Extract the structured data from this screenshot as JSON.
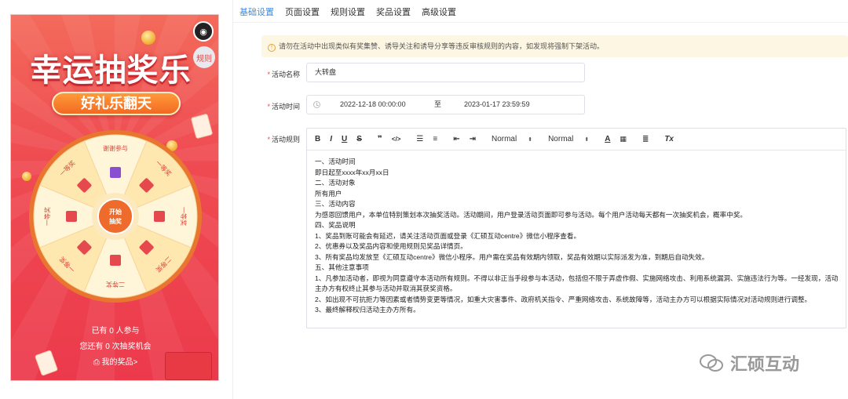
{
  "phone": {
    "title": "幸运抽奖乐",
    "subtitle": "好礼乐翻天",
    "rules_badge": "规则",
    "logo_glyph": "◉",
    "wheel": {
      "center_label_line1": "开始",
      "center_label_line2": "抽奖",
      "segments": [
        "谢谢参与",
        "一等奖",
        "一等奖",
        "二等奖",
        "二等奖",
        "一等奖",
        "一等奖",
        "一等奖"
      ]
    },
    "stats": {
      "participants": "已有 0 人参与",
      "chances": "您还有 0 次抽奖机会",
      "my_prizes": "我的奖品>"
    }
  },
  "tabs": [
    "基础设置",
    "页面设置",
    "规则设置",
    "奖品设置",
    "高级设置"
  ],
  "notice": "请勿在活动中出现类似有奖集赞、诱导关注和诱导分享等违反审核规则的内容，如发现将强制下架活动。",
  "form": {
    "name_label": "活动名称",
    "name_value": "大转盘",
    "time_label": "活动时间",
    "time_start": "2022-12-18 00:00:00",
    "time_sep": "至",
    "time_end": "2023-01-17 23:59:59",
    "rules_label": "活动规则"
  },
  "toolbar": {
    "bold": "B",
    "italic": "I",
    "underline": "U",
    "strike": "S",
    "quote": "❞",
    "code": "</>",
    "header_select": "Normal",
    "size_select": "Normal",
    "clean": "Tx"
  },
  "rules_content": [
    "一、活动时间",
    "即日起至xxxx年xx月xx日",
    "二、活动对象",
    "所有用户",
    "三、活动内容",
    "为感恩回馈用户，本单位特别策划本次抽奖活动。活动期间，用户登录活动页面即可参与活动。每个用户活动每天都有一次抽奖机会，概率中奖。",
    "四、奖品说明",
    "1、奖品到账可能会有延迟，请关注活动页面或登录《汇硕互动centre》微信小程序查看。",
    "2、优惠券以及奖品内容和使用规则见奖品详情页。",
    "3、所有奖品均发放至《汇硕互动centre》微信小程序。用户需在奖品有效期内领取，奖品有效期以实际派发为准，到期后自动失效。",
    "五、其他注意事项",
    "1、凡参加活动者，即视为同意遵守本活动所有规则。不得以非正当手段参与本活动，包括但不限于弄虚作假、实施网络攻击、利用系统漏洞、实施违法行为等。一经发现，活动主办方有权终止其参与活动并取消其获奖资格。",
    "2、如出现不可抗拒力等因素或者情势变更等情况，如重大灾害事件、政府机关指令、严重网络攻击、系统故障等，活动主办方可以根据实际情况对活动规则进行调整。",
    "3、最终解释权归活动主办方所有。"
  ],
  "watermark": "汇硕互动",
  "colors": {
    "accent": "#3a8ee6",
    "required": "#e84a4a",
    "brand_red": "#ec3a4c"
  }
}
